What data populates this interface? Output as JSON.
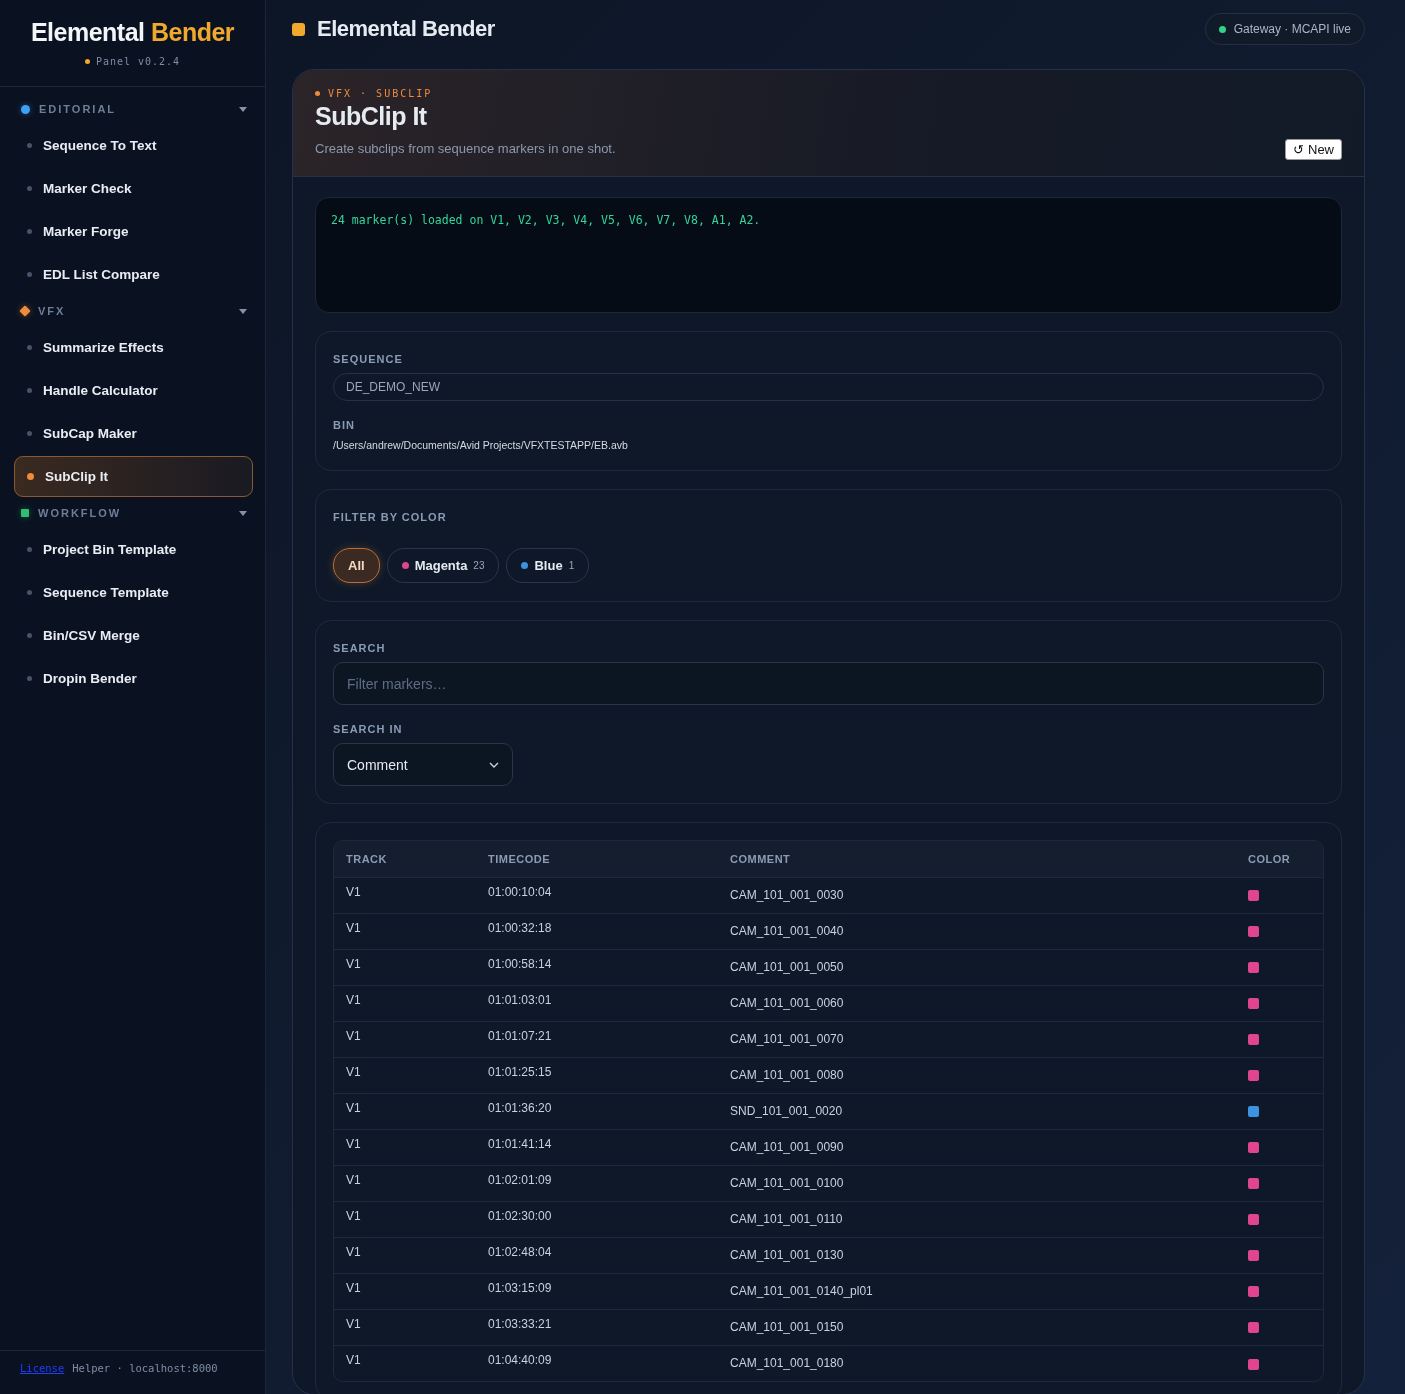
{
  "sidebar": {
    "brand": {
      "title": "Elemental",
      "accent": "Bender"
    },
    "version": "Panel v0.2.4",
    "groups": [
      {
        "label": "EDITORIAL",
        "kind": "circle",
        "color": "#3ba2f5",
        "expanded": true,
        "items": [
          {
            "label": "Sequence To Text",
            "selected": false
          },
          {
            "label": "Marker Check",
            "selected": false
          },
          {
            "label": "Marker Forge",
            "selected": false
          },
          {
            "label": "EDL List Compare",
            "selected": false
          }
        ]
      },
      {
        "label": "VFX",
        "kind": "diamond",
        "color": "#f08a3c",
        "expanded": true,
        "items": [
          {
            "label": "Summarize Effects",
            "selected": false
          },
          {
            "label": "Handle Calculator",
            "selected": false
          },
          {
            "label": "SubCap Maker",
            "selected": false
          },
          {
            "label": "SubClip It",
            "selected": true
          }
        ]
      },
      {
        "label": "WORKFLOW",
        "kind": "square",
        "color": "#2fbf71",
        "expanded": true,
        "items": [
          {
            "label": "Project Bin Template",
            "selected": false
          },
          {
            "label": "Sequence Template",
            "selected": false
          },
          {
            "label": "Bin/CSV Merge",
            "selected": false
          },
          {
            "label": "Dropin Bender",
            "selected": false
          }
        ]
      }
    ],
    "footer": {
      "link": "License",
      "text": "Helper · localhost:8000"
    }
  },
  "header": {
    "title": "Elemental Bender",
    "status": "Gateway · MCAPI live"
  },
  "tool": {
    "eyebrow": "VFX · SUBCLIP",
    "title": "SubClip It",
    "subtitle": "Create subclips from sequence markers in one shot.",
    "new_button": "↺ New"
  },
  "console": "24 marker(s) loaded on V1, V2, V3, V4, V5, V6, V7, V8, A1, A2.",
  "sequence": {
    "label": "SEQUENCE",
    "value": "DE_DEMO_NEW",
    "bin_label": "BIN",
    "bin": "/Users/andrew/Documents/Avid Projects/VFXTESTAPP/EB.avb"
  },
  "filter": {
    "label": "FILTER BY COLOR",
    "chips": [
      {
        "label": "All",
        "selected": true
      },
      {
        "label": "Magenta",
        "count": "23",
        "color": "#e0468f",
        "selected": false
      },
      {
        "label": "Blue",
        "count": "1",
        "color": "#3b94e0",
        "selected": false
      }
    ]
  },
  "search": {
    "label": "SEARCH",
    "placeholder": "Filter markers…",
    "in_label": "SEARCH IN",
    "in_value": "Comment"
  },
  "table": {
    "columns": [
      "TRACK",
      "TIMECODE",
      "COMMENT",
      "COLOR"
    ],
    "rows": [
      {
        "track": "V1",
        "timecode": "01:00:10:04",
        "comment": "CAM_101_001_0030",
        "color": "#e0468f"
      },
      {
        "track": "V1",
        "timecode": "01:00:32:18",
        "comment": "CAM_101_001_0040",
        "color": "#e0468f"
      },
      {
        "track": "V1",
        "timecode": "01:00:58:14",
        "comment": "CAM_101_001_0050",
        "color": "#e0468f"
      },
      {
        "track": "V1",
        "timecode": "01:01:03:01",
        "comment": "CAM_101_001_0060",
        "color": "#e0468f"
      },
      {
        "track": "V1",
        "timecode": "01:01:07:21",
        "comment": "CAM_101_001_0070",
        "color": "#e0468f"
      },
      {
        "track": "V1",
        "timecode": "01:01:25:15",
        "comment": "CAM_101_001_0080",
        "color": "#e0468f"
      },
      {
        "track": "V1",
        "timecode": "01:01:36:20",
        "comment": "SND_101_001_0020",
        "color": "#3b94e0"
      },
      {
        "track": "V1",
        "timecode": "01:01:41:14",
        "comment": "CAM_101_001_0090",
        "color": "#e0468f"
      },
      {
        "track": "V1",
        "timecode": "01:02:01:09",
        "comment": "CAM_101_001_0100",
        "color": "#e0468f"
      },
      {
        "track": "V1",
        "timecode": "01:02:30:00",
        "comment": "CAM_101_001_0110",
        "color": "#e0468f"
      },
      {
        "track": "V1",
        "timecode": "01:02:48:04",
        "comment": "CAM_101_001_0130",
        "color": "#e0468f"
      },
      {
        "track": "V1",
        "timecode": "01:03:15:09",
        "comment": "CAM_101_001_0140_pl01",
        "color": "#e0468f"
      },
      {
        "track": "V1",
        "timecode": "01:03:33:21",
        "comment": "CAM_101_001_0150",
        "color": "#e0468f"
      },
      {
        "track": "V1",
        "timecode": "01:04:40:09",
        "comment": "CAM_101_001_0180",
        "color": "#e0468f"
      }
    ]
  }
}
